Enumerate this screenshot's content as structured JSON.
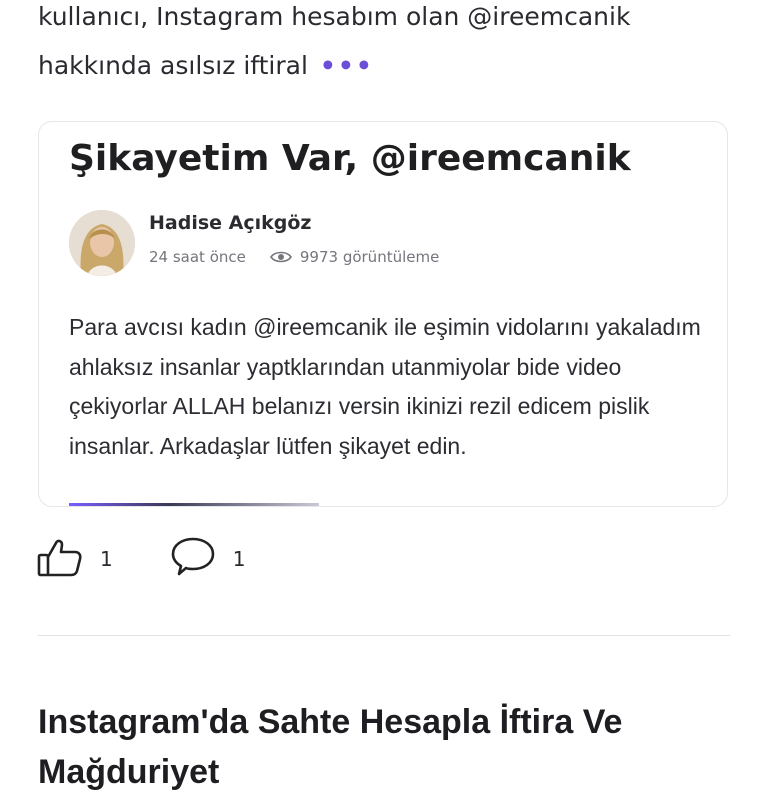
{
  "snippet": {
    "line1": "kullanıcı, Instagram hesabım olan @ireemcanik",
    "line2": "hakkında asılsız iftiral",
    "more_label": "•••"
  },
  "card": {
    "title": "Şikayetim Var, @ireemcanik",
    "author": "Hadise Açıkgöz",
    "time": "24 saat önce",
    "views": "9973 görüntüleme",
    "body": "Para avcısı kadın @ireemcanik ile eşimin vidolarını yakaladım ahlaksız insanlar yaptklarından utanmiyolar bide video çekiyorlar ALLAH belanızı versin ikinizi rezil edicem pislik insanlar. Arkadaşlar lütfen şikayet edin."
  },
  "actions": {
    "like_count": "1",
    "comment_count": "1"
  },
  "next_article": {
    "headline": "Instagram'da Sahte Hesapla İftira Ve Mağduriyet"
  },
  "icons": {
    "like": "thumbs-up-icon",
    "comment": "speech-bubble-icon",
    "views": "eye-icon"
  },
  "colors": {
    "accent": "#6b4fd8",
    "text": "#2a2a30",
    "muted": "#75757d"
  }
}
